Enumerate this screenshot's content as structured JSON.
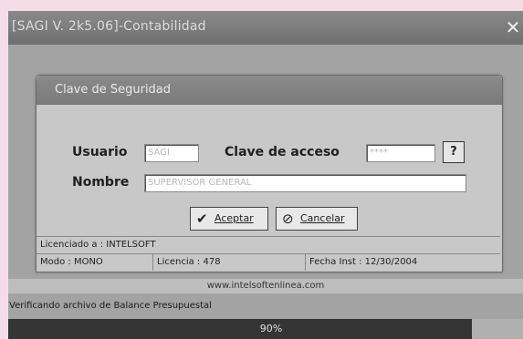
{
  "window": {
    "title": "[SAGI V. 2k5.06]-Contabilidad",
    "close_symbol": "✕"
  },
  "dialog": {
    "title": "Clave de Seguridad",
    "usuario_label": "Usuario",
    "usuario_value": "SAGI",
    "clave_label": "Clave de acceso",
    "clave_value": "****",
    "help_label": "?",
    "nombre_label": "Nombre",
    "nombre_value": "SUPERVISOR GENERAL",
    "aceptar_label": "Aceptar",
    "cancelar_label": "Cancelar"
  },
  "status": {
    "licenciado": "Licenciado a : INTELSOFT",
    "modo": "Modo : MONO",
    "licencia": "Licencia : 478",
    "fecha": "Fecha Inst : 12/30/2004"
  },
  "website": "www.intelsoftenlinea.com",
  "message": "Verificando archivo de Balance Presupuestal",
  "progress": {
    "label": "90%",
    "value": 0.9
  },
  "icons": {
    "aceptar": "checkmark-icon",
    "cancelar": "cancel-icon",
    "close": "close-icon"
  }
}
